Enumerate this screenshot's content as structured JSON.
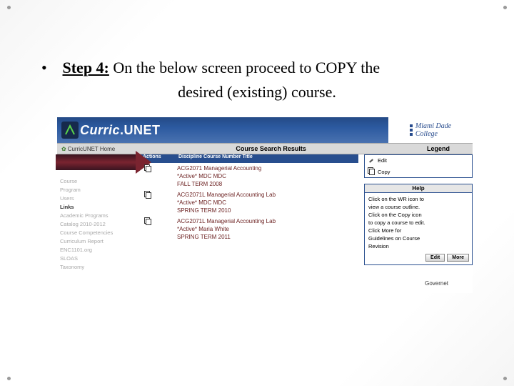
{
  "instruction": {
    "step_label": "Step 4:",
    "line1_rest": " On the below screen proceed to COPY the",
    "line2": "desired (existing) course."
  },
  "banner": {
    "brand_a": "Curric",
    "brand_b": "UNET",
    "college_l1": "Miami Dade",
    "college_l2": "College"
  },
  "subbar": {
    "home": "CurricUNET Home",
    "title": "Course Search Results",
    "legend": "Legend"
  },
  "leftnav": {
    "items": [
      "Course",
      "Program",
      "Users"
    ],
    "links_hd": "Links",
    "links": [
      "Academic Programs",
      "Catalog 2010-2012",
      "Course Competencies",
      "Curriculum Report",
      "ENC1101.org",
      "SLOAS",
      "Taxonomy"
    ]
  },
  "table": {
    "h_actions": "Actions",
    "h_disc": "Discipline Course Number Title",
    "rows": [
      {
        "action": "copy",
        "l1": "ACG2071 Managerial Accounting",
        "l2": "*Active* MDC MDC",
        "l3": "FALL TERM 2008"
      },
      {
        "action": "copy",
        "l1": "ACG2071L Managerial Accounting Lab",
        "l2": "*Active* MDC MDC",
        "l3": "SPRING TERM 2010"
      },
      {
        "action": "copy",
        "l1": "ACG2071L Managerial Accounting Lab",
        "l2": "*Active* Maria White",
        "l3": "SPRING TERM 2011"
      }
    ]
  },
  "legend": {
    "edit": "Edit",
    "copy": "Copy"
  },
  "help": {
    "heading": "Help",
    "body_l1": "Click on the WR icon to",
    "body_l2": "view a course outline.",
    "body_l3": "Click on the Copy icon",
    "body_l4": "to copy a course to edit.",
    "body_l5": "Click More for",
    "body_l6": "Guidelines on Course",
    "body_l7": "Revision",
    "btn_edit": "Edit",
    "btn_more": "More"
  },
  "footer": "Governet"
}
